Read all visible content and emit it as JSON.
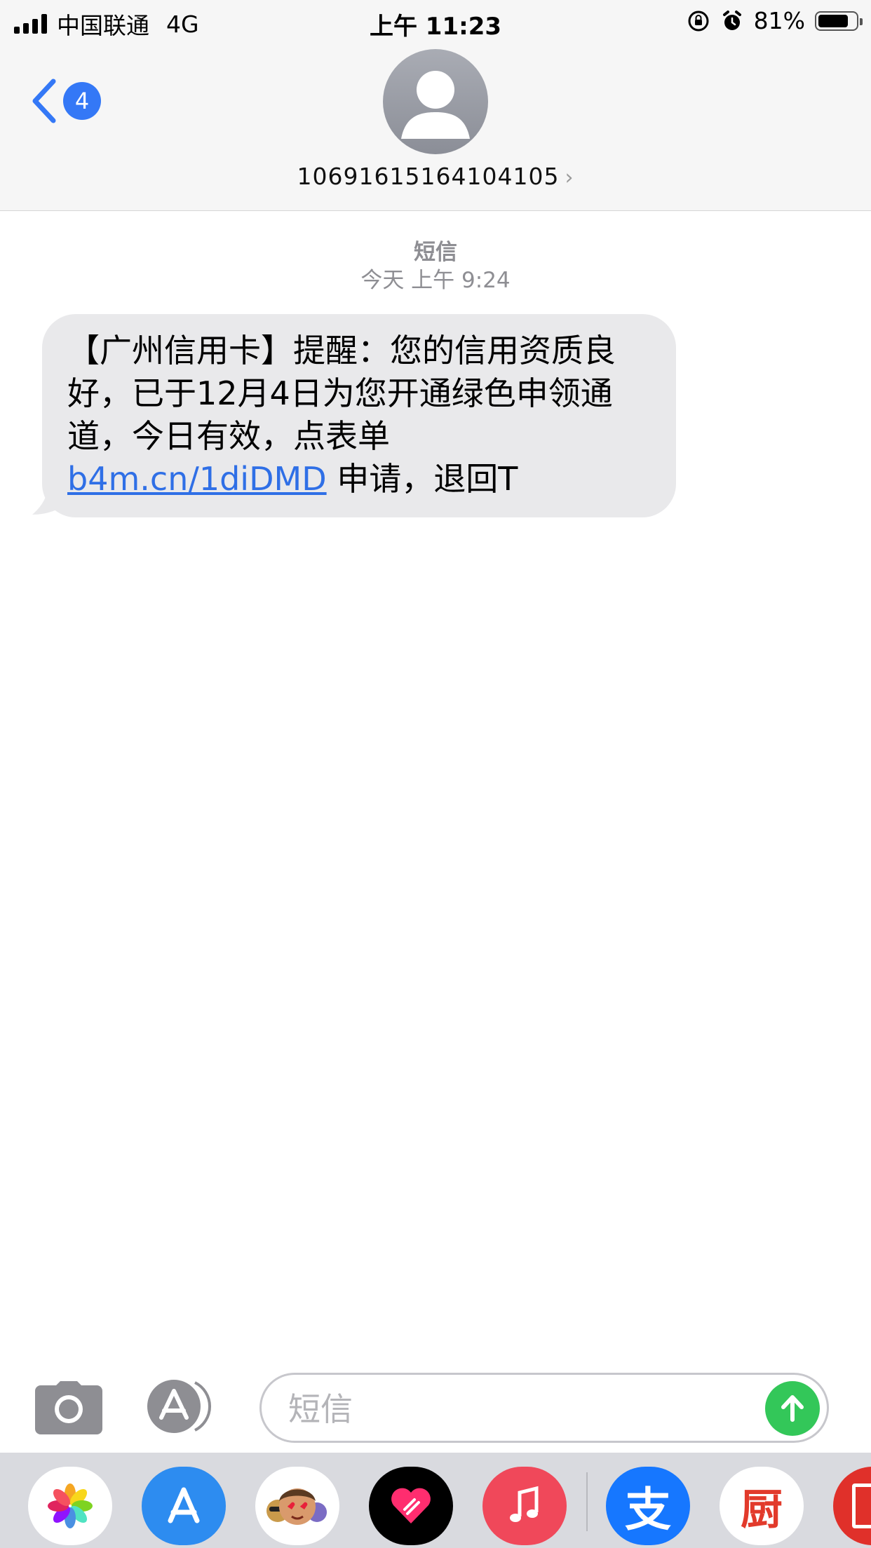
{
  "status_bar": {
    "carrier": "中国联通",
    "network": "4G",
    "time": "上午 11:23",
    "battery_percent": "81%",
    "battery_level": 0.81,
    "icons": [
      "signal-icon",
      "orientation-lock-icon",
      "alarm-icon",
      "battery-icon"
    ]
  },
  "header": {
    "back_count": "4",
    "contact": "10691615164104105",
    "chevron": "›"
  },
  "conversation": {
    "service_label": "短信",
    "timestamp": "今天 上午 9:24",
    "message": {
      "text_before_link": "【广州信用卡】提醒：您的信用资质良好，已于12月4日为您开通绿色申领通道，今日有效，点表单 ",
      "link": "b4m.cn/1diDMD",
      "text_after_link": " 申请，退回T"
    }
  },
  "input_bar": {
    "placeholder": "短信",
    "value": ""
  },
  "app_drawer": {
    "apps": [
      "photos-icon",
      "app-store-icon",
      "memoji-icon",
      "digital-touch-icon",
      "music-icon",
      "alipay-icon",
      "xiachufang-icon",
      "partial-app-icon"
    ],
    "alipay_glyph": "支",
    "kitchen_glyph": "厨"
  },
  "colors": {
    "accent": "#3478f6",
    "send": "#33c759",
    "bubble": "#e9e9eb",
    "link": "#2f6fe6"
  }
}
